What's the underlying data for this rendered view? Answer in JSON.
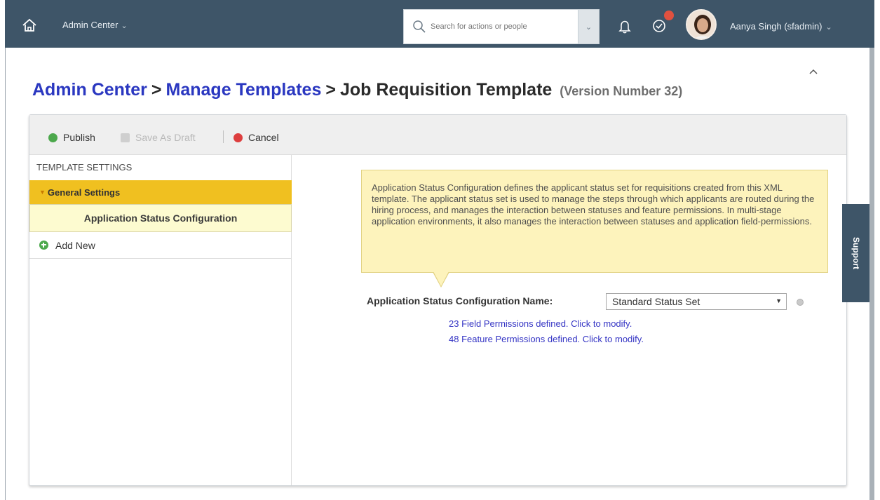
{
  "header": {
    "app_menu_label": "Admin Center",
    "search_placeholder": "Search for actions or people",
    "user_name": "Aanya Singh (sfadmin)"
  },
  "breadcrumb": {
    "items": [
      "Admin Center",
      "Manage Templates"
    ],
    "current": "Job Requisition Template",
    "version": "(Version Number 32)",
    "separator": ">"
  },
  "toolbar": {
    "publish_label": "Publish",
    "save_draft_label": "Save As Draft",
    "cancel_label": "Cancel"
  },
  "sidebar": {
    "title": "TEMPLATE SETTINGS",
    "section_label": "General Settings",
    "selected_item": "Application Status Configuration",
    "add_new_label": "Add New"
  },
  "content": {
    "tooltip_text": "Application Status Configuration defines the applicant status set for requisitions created from this XML template. The applicant status set is used to manage the steps through which applicants are routed during the hiring process, and manages the interaction between statuses and feature permissions. In multi-stage application environments, it also manages the interaction between statuses and application field-permissions.",
    "field_label": "Application Status Configuration Name:",
    "select_value": "Standard Status Set",
    "field_permissions_link": "23 Field Permissions defined. Click to modify.",
    "feature_permissions_link": "48 Feature Permissions defined. Click to modify."
  },
  "support_label": "Support",
  "colors": {
    "topbar": "#3e5568",
    "accent_link": "#2a37c0",
    "selected_section": "#f0c020",
    "tooltip_bg": "#fdf3bc"
  },
  "icons": [
    "home-icon",
    "chevron-down-icon",
    "search-icon",
    "bell-icon",
    "todo-check-icon",
    "avatar",
    "collapse-chevron-icon",
    "publish-icon",
    "save-draft-icon",
    "cancel-icon",
    "add-icon",
    "info-icon"
  ]
}
